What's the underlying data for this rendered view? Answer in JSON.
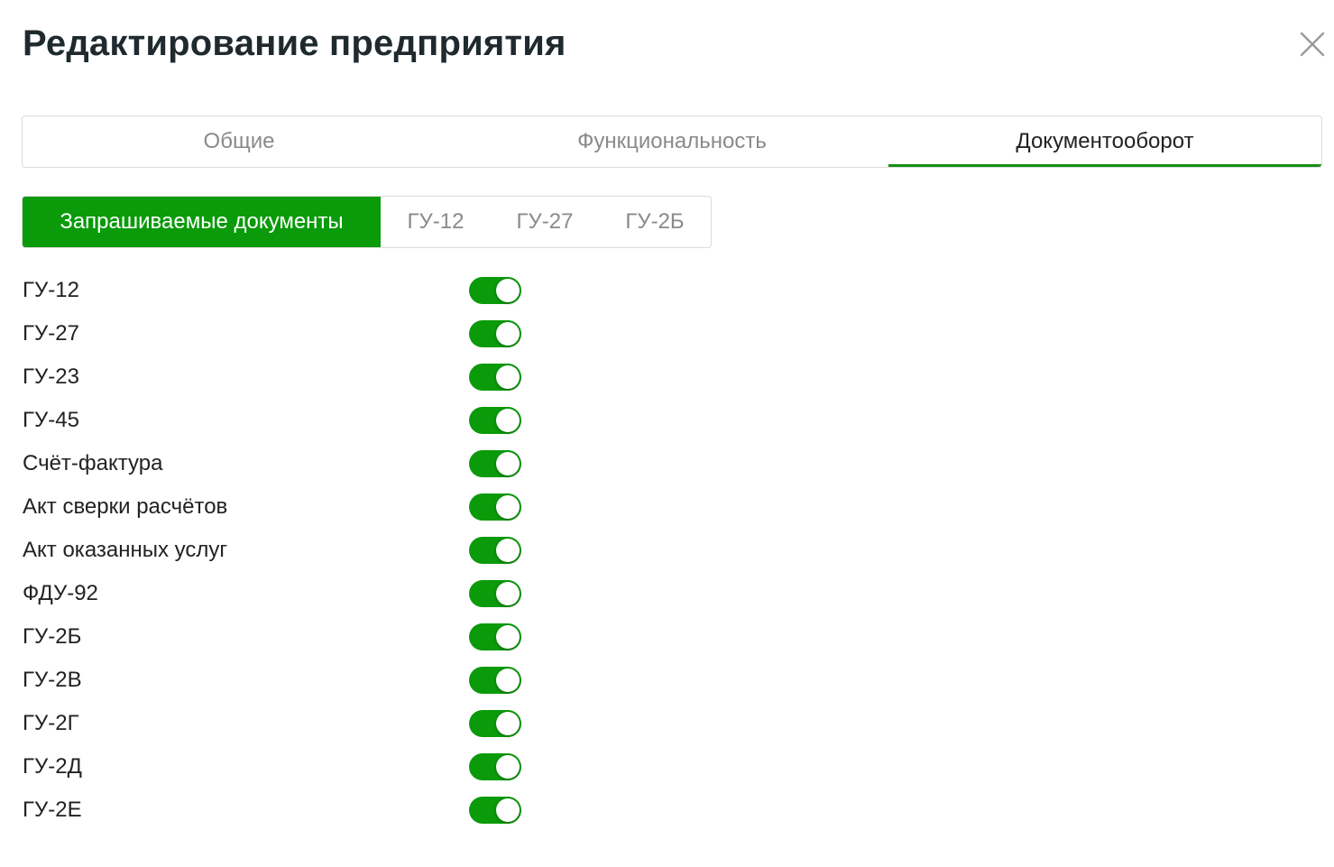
{
  "header": {
    "title": "Редактирование предприятия",
    "close_icon": "close-icon"
  },
  "main_tabs": [
    {
      "label": "Общие",
      "active": false
    },
    {
      "label": "Функциональность",
      "active": false
    },
    {
      "label": "Документооборот",
      "active": true
    }
  ],
  "sub_tabs": [
    {
      "label": "Запрашиваемые документы",
      "active": true
    },
    {
      "label": "ГУ-12",
      "active": false
    },
    {
      "label": "ГУ-27",
      "active": false
    },
    {
      "label": "ГУ-2Б",
      "active": false
    }
  ],
  "documents": [
    {
      "label": "ГУ-12",
      "enabled": true
    },
    {
      "label": "ГУ-27",
      "enabled": true
    },
    {
      "label": "ГУ-23",
      "enabled": true
    },
    {
      "label": "ГУ-45",
      "enabled": true
    },
    {
      "label": "Счёт-фактура",
      "enabled": true
    },
    {
      "label": "Акт сверки расчётов",
      "enabled": true
    },
    {
      "label": "Акт оказанных услуг",
      "enabled": true
    },
    {
      "label": "ФДУ-92",
      "enabled": true
    },
    {
      "label": "ГУ-2Б",
      "enabled": true
    },
    {
      "label": "ГУ-2В",
      "enabled": true
    },
    {
      "label": "ГУ-2Г",
      "enabled": true
    },
    {
      "label": "ГУ-2Д",
      "enabled": true
    },
    {
      "label": "ГУ-2Е",
      "enabled": true
    }
  ],
  "colors": {
    "accent": "#0a9a0a",
    "tab_underline": "#159015",
    "inactive_text": "#8a8a8a",
    "border": "#dcdcdc"
  }
}
